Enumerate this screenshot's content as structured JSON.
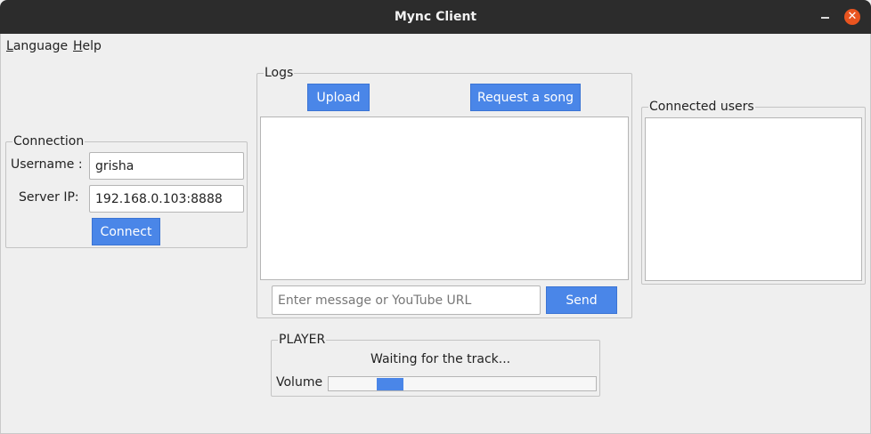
{
  "window": {
    "title": "Mync Client",
    "minimize_icon": "minimize-icon",
    "close_icon": "close-icon",
    "close_glyph": "✕"
  },
  "menu": [
    {
      "first": "L",
      "rest": "anguage"
    },
    {
      "first": "H",
      "rest": "elp"
    }
  ],
  "connection": {
    "legend": "Connection",
    "username_label": "Username :",
    "username_value": "grisha",
    "server_label": "Server IP:",
    "server_value": "192.168.0.103:8888",
    "connect_label": "Connect"
  },
  "logs": {
    "legend": "Logs",
    "upload_label": "Upload",
    "request_label": "Request a song",
    "message_placeholder": "Enter message or YouTube URL",
    "send_label": "Send"
  },
  "users": {
    "legend": "Connected users"
  },
  "player": {
    "legend": "PLAYER",
    "status": "Waiting for the track...",
    "volume_label": "Volume",
    "volume_fraction": 0.2
  },
  "colors": {
    "accent": "#4a86e8",
    "close": "#e9541f",
    "titlebar": "#2c2c2c"
  }
}
